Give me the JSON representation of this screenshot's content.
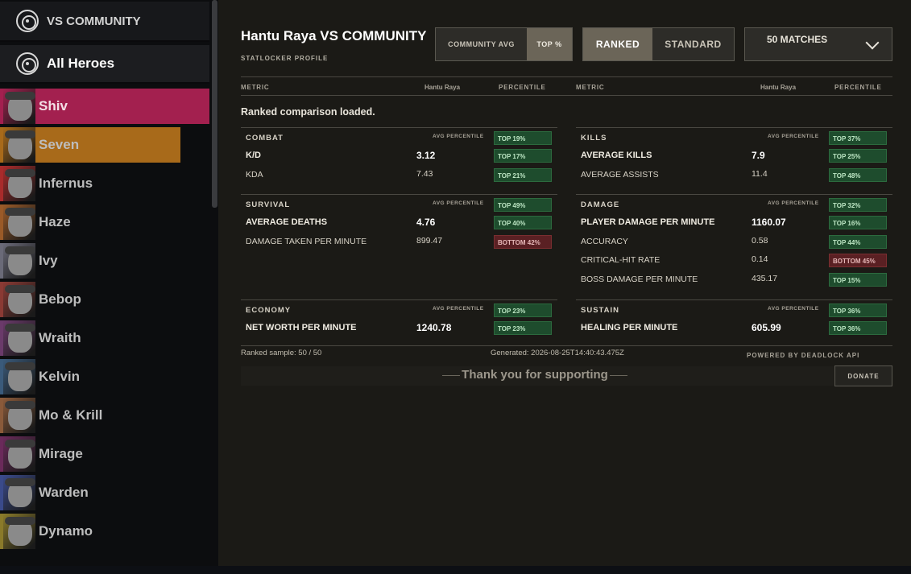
{
  "sidebar": {
    "header": "VS COMMUNITY",
    "all_heroes": "All Heroes",
    "heroes": [
      {
        "name": "Shiv",
        "color": "#a3204f",
        "active": true
      },
      {
        "name": "Seven",
        "color": "#a86a1a",
        "active": false
      },
      {
        "name": "Infernus",
        "color": "#a82b2b",
        "active": false
      },
      {
        "name": "Haze",
        "color": "#9a5a28",
        "active": false
      },
      {
        "name": "Ivy",
        "color": "#6a6a78",
        "active": false
      },
      {
        "name": "Bebop",
        "color": "#8a3a34",
        "active": false
      },
      {
        "name": "Wraith",
        "color": "#6a3a6a",
        "active": false
      },
      {
        "name": "Kelvin",
        "color": "#3a5a7a",
        "active": false
      },
      {
        "name": "Mo & Krill",
        "color": "#8a5a3a",
        "active": false
      },
      {
        "name": "Mirage",
        "color": "#6a2a5a",
        "active": false
      },
      {
        "name": "Warden",
        "color": "#3a4a8a",
        "active": false
      },
      {
        "name": "Dynamo",
        "color": "#8a7a2a",
        "active": false
      }
    ]
  },
  "header": {
    "title": "Hantu Raya VS COMMUNITY",
    "subtitle": "STATLOCKER PROFILE",
    "compare": {
      "option1": "COMMUNITY AVG",
      "option2": "TOP %"
    },
    "mode": {
      "option1": "RANKED",
      "option2": "STANDARD"
    },
    "matches": "50 MATCHES"
  },
  "columns": {
    "metric": "METRIC",
    "player": "Hantu Raya",
    "percentile": "PERCENTILE"
  },
  "status": "Ranked comparison loaded.",
  "avg_label": "AVG PERCENTILE",
  "sections": {
    "combat": {
      "title": "COMBAT",
      "avg": "TOP 19%",
      "rows": [
        {
          "metric": "K/D",
          "value": "3.12",
          "pct": "TOP 17%"
        },
        {
          "metric": "KDA",
          "value": "7.43",
          "pct": "TOP 21%"
        }
      ]
    },
    "kills": {
      "title": "KILLS",
      "avg": "TOP 37%",
      "rows": [
        {
          "metric": "AVERAGE KILLS",
          "value": "7.9",
          "pct": "TOP 25%"
        },
        {
          "metric": "AVERAGE ASSISTS",
          "value": "11.4",
          "pct": "TOP 48%"
        }
      ]
    },
    "survival": {
      "title": "SURVIVAL",
      "avg": "TOP 49%",
      "rows": [
        {
          "metric": "AVERAGE DEATHS",
          "value": "4.76",
          "pct": "TOP 40%"
        },
        {
          "metric": "DAMAGE TAKEN PER MINUTE",
          "value": "899.47",
          "pct": "BOTTOM 42%"
        }
      ]
    },
    "damage": {
      "title": "DAMAGE",
      "avg": "TOP 32%",
      "rows": [
        {
          "metric": "PLAYER DAMAGE PER MINUTE",
          "value": "1160.07",
          "pct": "TOP 16%"
        },
        {
          "metric": "ACCURACY",
          "value": "0.58",
          "pct": "TOP 44%"
        },
        {
          "metric": "CRITICAL-HIT RATE",
          "value": "0.14",
          "pct": "BOTTOM 45%"
        },
        {
          "metric": "BOSS DAMAGE PER MINUTE",
          "value": "435.17",
          "pct": "TOP 15%"
        }
      ]
    },
    "economy": {
      "title": "ECONOMY",
      "avg": "TOP 23%",
      "rows": [
        {
          "metric": "NET WORTH PER MINUTE",
          "value": "1240.78",
          "pct": "TOP 23%"
        }
      ]
    },
    "sustain": {
      "title": "SUSTAIN",
      "avg": "TOP 36%",
      "rows": [
        {
          "metric": "HEALING PER MINUTE",
          "value": "605.99",
          "pct": "TOP 36%"
        }
      ]
    }
  },
  "footer": {
    "sample": "Ranked sample: 50 / 50",
    "generated": "Generated: 2026-08-25T14:40:43.475Z",
    "powered": "POWERED BY DEADLOCK API",
    "thanks": "Thank you for supporting",
    "donate": "DONATE"
  },
  "colors": {
    "good": "#1e4c2d",
    "bad": "#5a2023",
    "accent": "#6b6558"
  }
}
